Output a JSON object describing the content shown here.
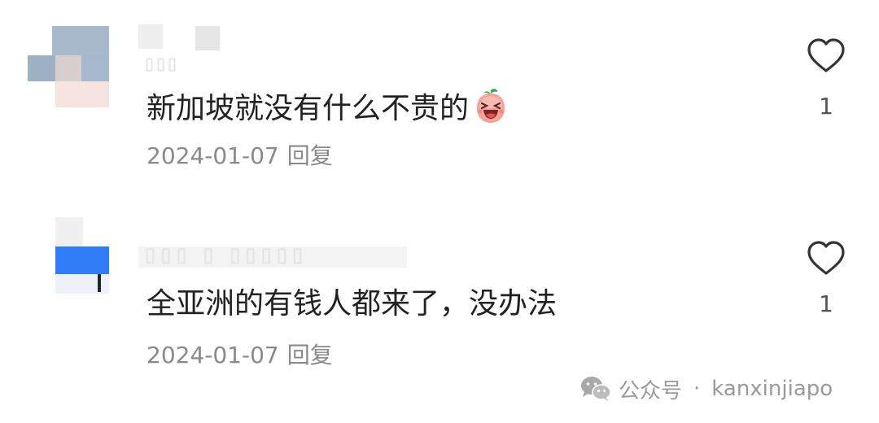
{
  "comments": [
    {
      "text": "新加坡就没有什么不贵的",
      "emoji": "laughing-peach-emoji",
      "date": "2024-01-07",
      "reply_label": "回复",
      "like_count": "1"
    },
    {
      "text": "全亚洲的有钱人都来了，没办法",
      "date": "2024-01-07",
      "reply_label": "回复",
      "like_count": "1"
    }
  ],
  "watermark": {
    "icon": "wechat-icon",
    "label": "公众号",
    "separator": "·",
    "account": "kanxinjiapo"
  },
  "colors": {
    "text": "#222222",
    "meta": "#8a8a8a",
    "avatar_blue": "#2f7cf6"
  }
}
